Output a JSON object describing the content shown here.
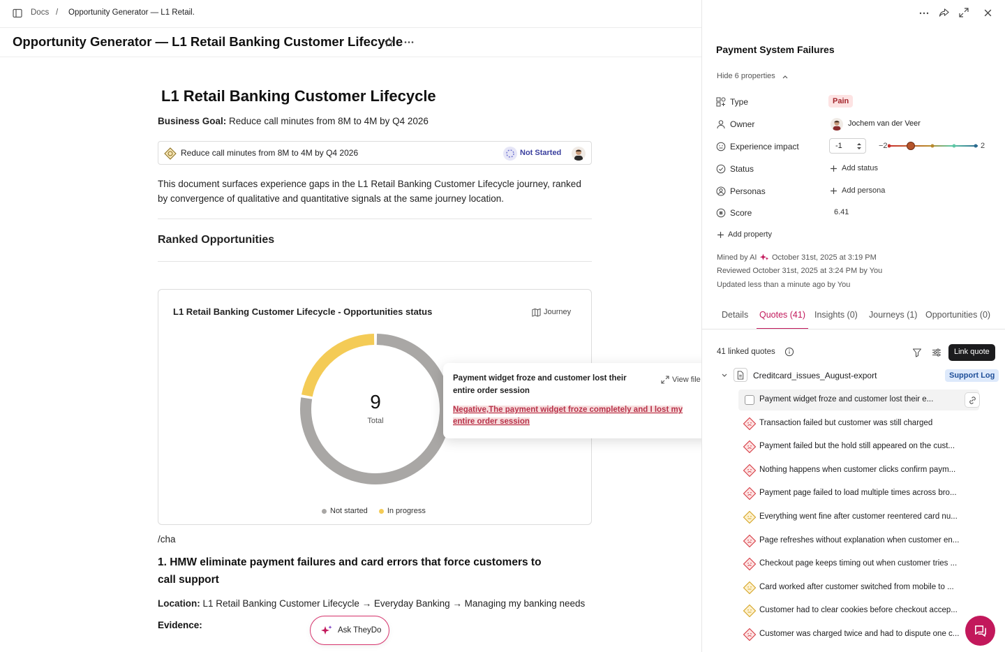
{
  "topbar": {
    "crumb_root": "Docs",
    "crumb_sep": "/",
    "crumb_current": "Opportunity Generator — L1 Retail."
  },
  "doc": {
    "title": "Opportunity Generator — L1 Retail Banking Customer Lifecycle",
    "heading": "L1 Retail Banking Customer Lifecycle",
    "goal_label": "Business Goal:",
    "goal_text": " Reduce call minutes from 8M to 4M by Q4 2026",
    "goal_card_text": "Reduce call minutes from 8M to 4M by Q4 2026",
    "goal_status": "Not Started",
    "intro_line1": "This document surfaces experience gaps in the L1 Retail Banking Customer Lifecycle journey, ranked",
    "intro_line2": "by convergence of qualitative and quantitative signals at the same journey location.",
    "ranked_heading": "Ranked Opportunities",
    "slash_text": "/cha",
    "hmw_line1": "1. HMW eliminate payment failures and card errors that force customers to",
    "hmw_line2": "call support",
    "location_label": "Location:",
    "location_text": " L1 Retail Banking Customer Lifecycle → Everyday Banking → Managing my banking needs",
    "evidence_label": "Evidence:",
    "ask_button": "Ask TheyDo"
  },
  "chart_card": {
    "title": "L1 Retail Banking Customer Lifecycle - Opportunities status",
    "journey_button": "Journey",
    "center_value": "9",
    "center_label": "Total",
    "legend": [
      {
        "label": "Not started",
        "color": "#a9a7a5"
      },
      {
        "label": "In progress",
        "color": "#f4cb56"
      }
    ]
  },
  "chart_data": {
    "type": "pie",
    "title": "L1 Retail Banking Customer Lifecycle - Opportunities status",
    "categories": [
      "Not started",
      "In progress"
    ],
    "values": [
      7,
      2
    ],
    "total": 9,
    "colors": [
      "#a9a7a5",
      "#f4cb56"
    ]
  },
  "popover": {
    "title_line1": "Payment widget froze and customer lost their",
    "title_line2": "entire order session",
    "view_file": "View file",
    "highlight_line1": "Negative,The payment widget froze completely and I lost my",
    "highlight_line2": "entire order session"
  },
  "panel": {
    "title": "Payment System Failures",
    "hide_props": "Hide 6 properties",
    "props": {
      "type_label": "Type",
      "type_value": "Pain",
      "owner_label": "Owner",
      "owner_value": "Jochem van der Veer",
      "impact_label": "Experience impact",
      "impact_value": "-1",
      "impact_min": "−2",
      "impact_max": "2",
      "status_label": "Status",
      "status_value": "Add status",
      "personas_label": "Personas",
      "personas_value": "Add persona",
      "score_label": "Score",
      "score_value": "6.41"
    },
    "add_property": "Add property",
    "mined_prefix": "Mined by AI",
    "mined_date": "October 31st, 2025 at 3:19 PM",
    "reviewed": "Reviewed October 31st, 2025 at 3:24 PM by You",
    "updated": "Updated less than a minute ago by You",
    "tabs": [
      "Details",
      "Quotes (41)",
      "Insights (0)",
      "Journeys (1)",
      "Opportunities (0)"
    ],
    "linked_count": "41 linked quotes",
    "link_quote": "Link quote",
    "file_name": "Creditcard_issues_August-export",
    "file_badge": "Support Log",
    "quotes": [
      {
        "text": "Payment widget froze and customer lost their e...",
        "sentiment": "none"
      },
      {
        "text": "Transaction failed but customer was still charged",
        "sentiment": "negative"
      },
      {
        "text": "Payment failed but the hold still appeared on the cust...",
        "sentiment": "negative"
      },
      {
        "text": "Nothing happens when customer clicks confirm paym...",
        "sentiment": "negative"
      },
      {
        "text": "Payment page failed to load multiple times across bro...",
        "sentiment": "negative"
      },
      {
        "text": "Everything went fine after customer reentered card nu...",
        "sentiment": "neutral"
      },
      {
        "text": "Page refreshes without explanation when customer en...",
        "sentiment": "negative"
      },
      {
        "text": "Checkout page keeps timing out when customer tries ...",
        "sentiment": "negative"
      },
      {
        "text": "Card worked after customer switched from mobile to ...",
        "sentiment": "neutral"
      },
      {
        "text": "Customer had to clear cookies before checkout accep...",
        "sentiment": "neutral"
      },
      {
        "text": "Customer was charged twice and had to dispute one c...",
        "sentiment": "negative"
      }
    ]
  },
  "colors": {
    "accent": "#c2185b",
    "negative": "#e86a6a",
    "neutral": "#f1c24d",
    "pain_bg": "#fde3e3",
    "badge_bg": "#dde9fb"
  }
}
